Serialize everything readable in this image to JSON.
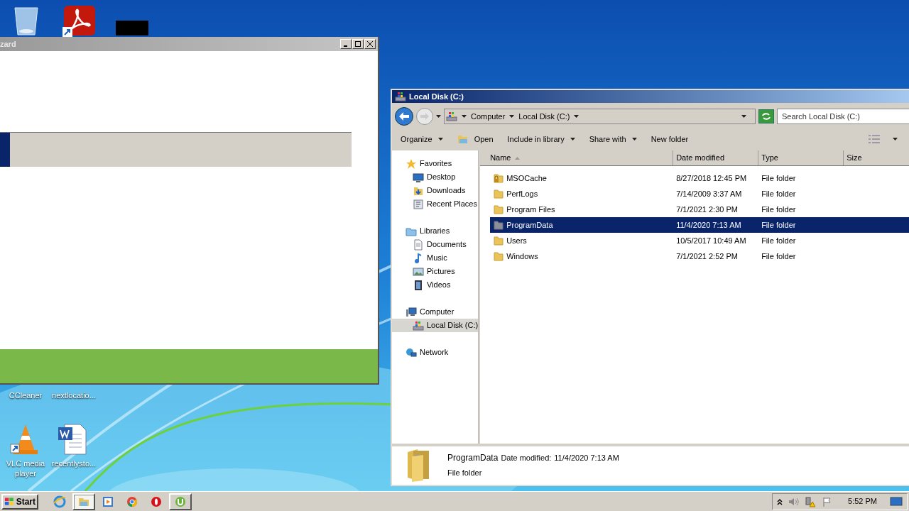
{
  "desktop_icons": [
    {
      "label": "CCleaner",
      "kind": "hidden"
    },
    {
      "label": "nextlocatio...",
      "kind": "hidden"
    },
    {
      "label": "VLC media player",
      "kind": "cone"
    },
    {
      "label": "recentlysto...",
      "kind": "document"
    }
  ],
  "wizard_window": {
    "title": "zard"
  },
  "explorer": {
    "title": "Local Disk (C:)",
    "breadcrumb": [
      "Computer",
      "Local Disk (C:)"
    ],
    "search": {
      "placeholder": "Search Local Disk (C:)"
    },
    "toolbar": [
      {
        "label": "Organize",
        "kind": "menu"
      },
      {
        "label": "Open",
        "kind": "icon"
      },
      {
        "label": "Include in library",
        "kind": "menu"
      },
      {
        "label": "Share with",
        "kind": "menu"
      },
      {
        "label": "New folder",
        "kind": "plain"
      }
    ],
    "nav": [
      {
        "label": "Favorites",
        "kind": "star",
        "selected": false,
        "children": [
          {
            "label": "Desktop",
            "kind": "desktop",
            "selected": false
          },
          {
            "label": "Downloads",
            "kind": "downloads",
            "selected": false
          },
          {
            "label": "Recent Places",
            "kind": "recent",
            "selected": false
          }
        ]
      },
      {
        "label": "Libraries",
        "kind": "library",
        "selected": false,
        "children": [
          {
            "label": "Documents",
            "kind": "document",
            "selected": false
          },
          {
            "label": "Music",
            "kind": "music",
            "selected": false
          },
          {
            "label": "Pictures",
            "kind": "pictures",
            "selected": false
          },
          {
            "label": "Videos",
            "kind": "videos",
            "selected": false
          }
        ]
      },
      {
        "label": "Computer",
        "kind": "computer",
        "selected": false,
        "children": [
          {
            "label": "Local Disk (C:)",
            "kind": "disk",
            "selected": true
          }
        ]
      },
      {
        "label": "Network",
        "kind": "network",
        "selected": false
      }
    ],
    "columns": [
      "Name",
      "Date modified",
      "Type",
      "Size"
    ],
    "rows": [
      {
        "name": "MSOCache",
        "date": "8/27/2018 12:45 PM",
        "type": "File folder",
        "kind": "locked",
        "selected": false
      },
      {
        "name": "PerfLogs",
        "date": "7/14/2009 3:37 AM",
        "type": "File folder",
        "kind": "folder",
        "selected": false
      },
      {
        "name": "Program Files",
        "date": "7/1/2021 2:30 PM",
        "type": "File folder",
        "kind": "folder",
        "selected": false
      },
      {
        "name": "ProgramData",
        "date": "11/4/2020 7:13 AM",
        "type": "File folder",
        "kind": "hidden",
        "selected": true
      },
      {
        "name": "Users",
        "date": "10/5/2017 10:49 AM",
        "type": "File folder",
        "kind": "folder",
        "selected": false
      },
      {
        "name": "Windows",
        "date": "7/1/2021 2:52 PM",
        "type": "File folder",
        "kind": "folder",
        "selected": false
      }
    ],
    "details": {
      "name": "ProgramData",
      "date_label": "Date modified:",
      "date": "11/4/2020 7:13 AM",
      "type": "File folder"
    }
  },
  "taskbar": {
    "start": "Start",
    "apps": [
      {
        "kind": "ie",
        "open": false,
        "selected": false
      },
      {
        "kind": "explorer",
        "open": true,
        "selected": true
      },
      {
        "kind": "media",
        "open": false,
        "selected": false
      },
      {
        "kind": "chrome",
        "open": false,
        "selected": false
      },
      {
        "kind": "opera",
        "open": false,
        "selected": false
      },
      {
        "kind": "torrent",
        "open": true,
        "selected": false
      }
    ],
    "clock": "5:52 PM"
  }
}
